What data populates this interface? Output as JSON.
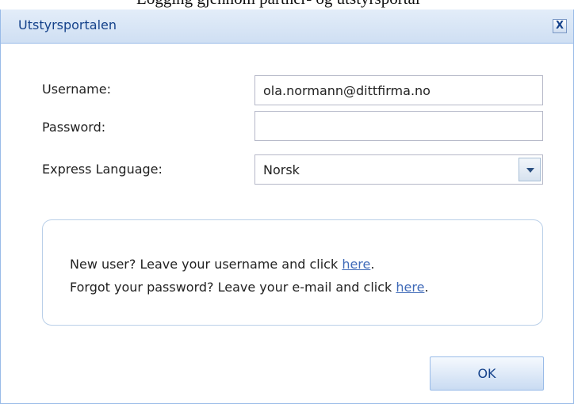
{
  "clipped_heading": "Logging gjennom partner- og utstyrsportal",
  "dialog": {
    "title": "Utstyrsportalen",
    "close_label": "X"
  },
  "form": {
    "username_label": "Username:",
    "username_value": "ola.normann@dittfirma.no",
    "password_label": "Password:",
    "password_value": "",
    "language_label": "Express Language:",
    "language_value": "Norsk"
  },
  "info": {
    "line1_text": "New user? Leave your username and click ",
    "line1_link": "here",
    "line1_end": ".",
    "line2_text": "Forgot your password? Leave your e-mail and click ",
    "line2_link": "here",
    "line2_end": "."
  },
  "ok_label": "OK",
  "colors": {
    "titlebar": "#dbe7f6",
    "title_text": "#15428b",
    "link": "#3f6ab8",
    "border": "#99bbe8"
  }
}
